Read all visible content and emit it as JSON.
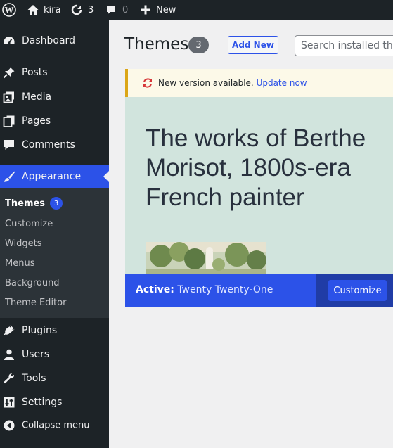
{
  "adminbar": {
    "site_name": "kira",
    "updates_count": "3",
    "comments_count": "0",
    "new_label": "New"
  },
  "sidebar": {
    "items": [
      {
        "label": "Dashboard",
        "icon": "dashboard-icon"
      },
      {
        "label": "Posts",
        "icon": "pin-icon"
      },
      {
        "label": "Media",
        "icon": "media-icon"
      },
      {
        "label": "Pages",
        "icon": "pages-icon"
      },
      {
        "label": "Comments",
        "icon": "comment-icon"
      },
      {
        "label": "Appearance",
        "icon": "paintbrush-icon"
      },
      {
        "label": "Plugins",
        "icon": "plugin-icon"
      },
      {
        "label": "Users",
        "icon": "users-icon"
      },
      {
        "label": "Tools",
        "icon": "wrench-icon"
      },
      {
        "label": "Settings",
        "icon": "settings-icon"
      },
      {
        "label": "Collapse menu",
        "icon": "collapse-icon"
      }
    ],
    "submenu": [
      {
        "label": "Themes",
        "badge": "3"
      },
      {
        "label": "Customize"
      },
      {
        "label": "Widgets"
      },
      {
        "label": "Menus"
      },
      {
        "label": "Background"
      },
      {
        "label": "Theme Editor"
      }
    ]
  },
  "main": {
    "title": "Themes",
    "title_count": "3",
    "add_new": "Add New",
    "search_placeholder": "Search installed themes..."
  },
  "notice": {
    "text": "New version available.",
    "link": "Update now"
  },
  "theme": {
    "heading": "The works of Berthe Morisot, 1800s-era French painter",
    "active_prefix": "Active:",
    "active_name": "Twenty Twenty-One",
    "customize": "Customize"
  },
  "colors": {
    "accent": "#2c52e8",
    "adminbar": "#1d2327",
    "notice_border": "#dba617",
    "theme_bg": "#d1e4dd"
  }
}
